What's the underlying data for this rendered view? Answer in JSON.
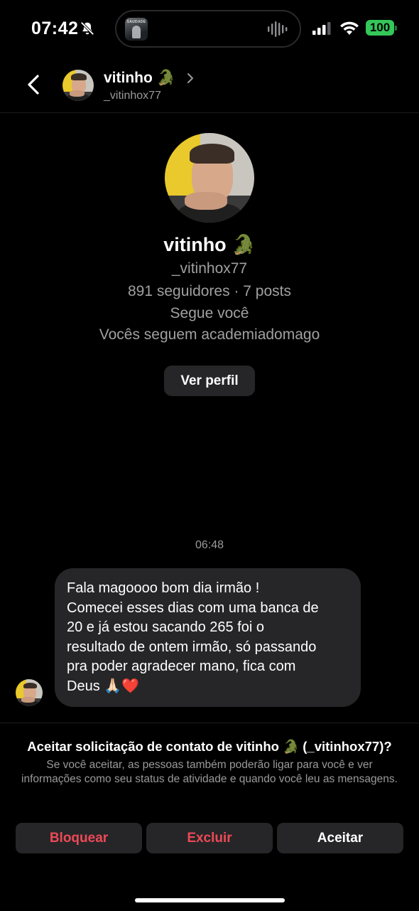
{
  "status_bar": {
    "time": "07:42",
    "battery": "100",
    "island_art_text": "SAUDADE"
  },
  "header": {
    "name": "vitinho 🐊",
    "username": "_vitinhox77"
  },
  "profile": {
    "name": "vitinho 🐊",
    "username": "_vitinhox77",
    "stats": "891 seguidores · 7 posts",
    "follows_you": "Segue você",
    "mutual": "Vocês seguem academiadomago",
    "view_profile_label": "Ver perfil"
  },
  "conversation": {
    "timestamp": "06:48",
    "message_lines": [
      "Fala magoooo bom dia irmão !",
      "Comecei esses dias com uma banca de",
      "20 e já estou sacando 265 foi o",
      "resultado de ontem irmão, só passando",
      "pra poder agradecer mano, fica com",
      "Deus 🙏🏻❤️"
    ]
  },
  "request": {
    "title": "Aceitar solicitação de contato de vitinho 🐊 (_vitinhox77)?",
    "description": "Se você aceitar, as pessoas também poderão ligar para você e ver informações como seu status de atividade e quando você leu as mensagens.",
    "block_label": "Bloquear",
    "delete_label": "Excluir",
    "accept_label": "Aceitar"
  },
  "colors": {
    "background": "#000000",
    "surface": "#262628",
    "danger": "#ed4956",
    "battery": "#34c759",
    "muted_text": "#9a9a9a"
  },
  "icons": [
    "bell-off-icon",
    "waveform-icon",
    "signal-icon",
    "wifi-icon",
    "back-icon",
    "chevron-right-icon"
  ]
}
